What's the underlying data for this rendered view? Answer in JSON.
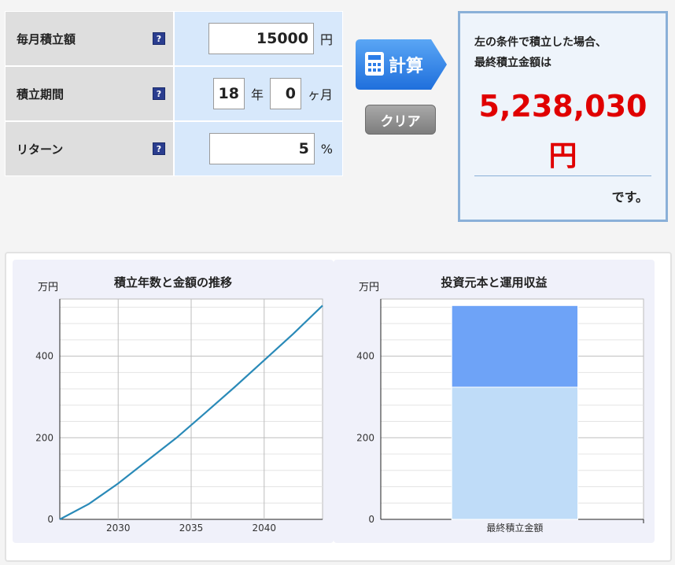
{
  "form": {
    "monthly": {
      "label": "毎月積立額",
      "value": "15000",
      "unit": "円"
    },
    "period": {
      "label": "積立期間",
      "years": "18",
      "years_unit": "年",
      "months": "0",
      "months_unit": "ヶ月"
    },
    "return": {
      "label": "リターン",
      "value": "5",
      "unit": "%"
    },
    "help_glyph": "?"
  },
  "buttons": {
    "calc": "計算",
    "clear": "クリア"
  },
  "result": {
    "line1": "左の条件で積立した場合、",
    "line2": "最終積立金額は",
    "amount": "5,238,030",
    "yen": "円",
    "desu": "です。"
  },
  "colors": {
    "accent_red": "#e00000",
    "line": "#2a8ab8",
    "bar_principal": "#bfdcf8",
    "bar_profit": "#6ea3f7"
  },
  "chart_data": [
    {
      "type": "line",
      "title": "積立年数と金額の推移",
      "ylabel": "万円",
      "x": [
        2026,
        2028,
        2030,
        2032,
        2034,
        2036,
        2038,
        2040,
        2042,
        2044
      ],
      "values": [
        0,
        38,
        88,
        144,
        200,
        262,
        325,
        390,
        455,
        524
      ],
      "x_ticks": [
        "2030",
        "2035",
        "2040"
      ],
      "y_ticks": [
        "0",
        "200",
        "400"
      ],
      "xlim": [
        2026,
        2044
      ],
      "ylim": [
        0,
        540
      ],
      "grid": true
    },
    {
      "type": "bar",
      "title": "投資元本と運用収益",
      "ylabel": "万円",
      "categories": [
        "最終積立金額"
      ],
      "series": [
        {
          "values": [
            324
          ]
        },
        {
          "values": [
            200
          ]
        }
      ],
      "y_ticks": [
        "0",
        "200",
        "400"
      ],
      "ylim": [
        0,
        540
      ],
      "stacked": true,
      "grid": true
    }
  ]
}
